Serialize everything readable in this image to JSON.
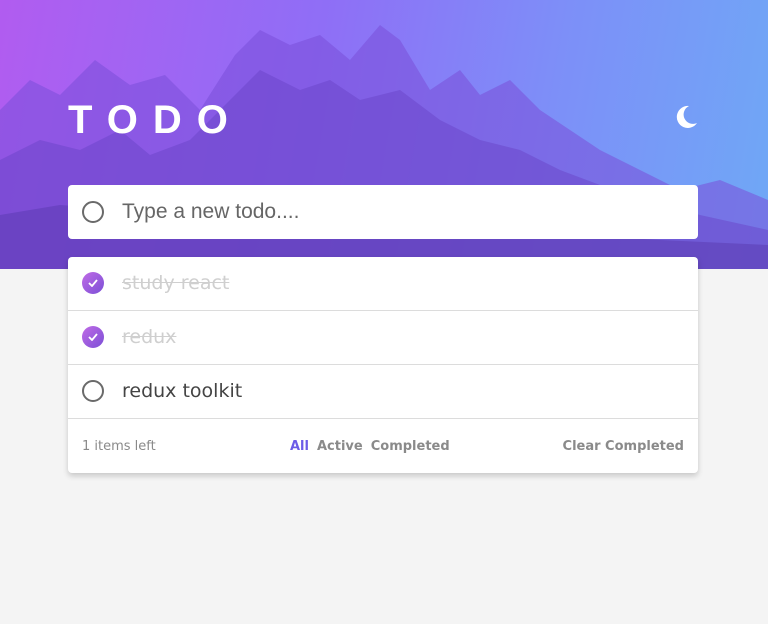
{
  "header": {
    "title": "TODO",
    "theme_icon": "moon-icon"
  },
  "new_todo": {
    "placeholder": "Type a new todo....",
    "value": ""
  },
  "todos": [
    {
      "label": "study react",
      "completed": true
    },
    {
      "label": "redux",
      "completed": true
    },
    {
      "label": "redux toolkit",
      "completed": false
    }
  ],
  "footer": {
    "items_left": "1 items left",
    "filters": [
      "All",
      "Active",
      "Completed"
    ],
    "active_filter": "All",
    "clear_label": "Clear Completed"
  },
  "colors": {
    "accent": "#6c5ce7",
    "check_gradient_start": "#c06be6",
    "check_gradient_end": "#7b4fd6",
    "background": "#f4f4f4"
  }
}
